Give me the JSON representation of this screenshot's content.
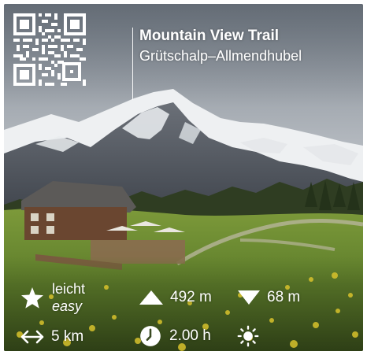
{
  "trail": {
    "title": "Mountain View Trail",
    "route": "Grütschalp–Allmendhubel"
  },
  "stats": {
    "difficulty_de": "leicht",
    "difficulty_en": "easy",
    "ascent": "492 m",
    "descent": "68 m",
    "distance": "5 km",
    "duration": "2.00 h"
  },
  "icons": {
    "difficulty": "star-icon",
    "ascent": "up-triangle-icon",
    "descent": "down-triangle-icon",
    "distance": "horizontal-arrows-icon",
    "duration": "clock-icon",
    "weather": "sun-icon",
    "code": "qr-code-icon"
  },
  "colors": {
    "overlay_text": "#ffffff"
  }
}
